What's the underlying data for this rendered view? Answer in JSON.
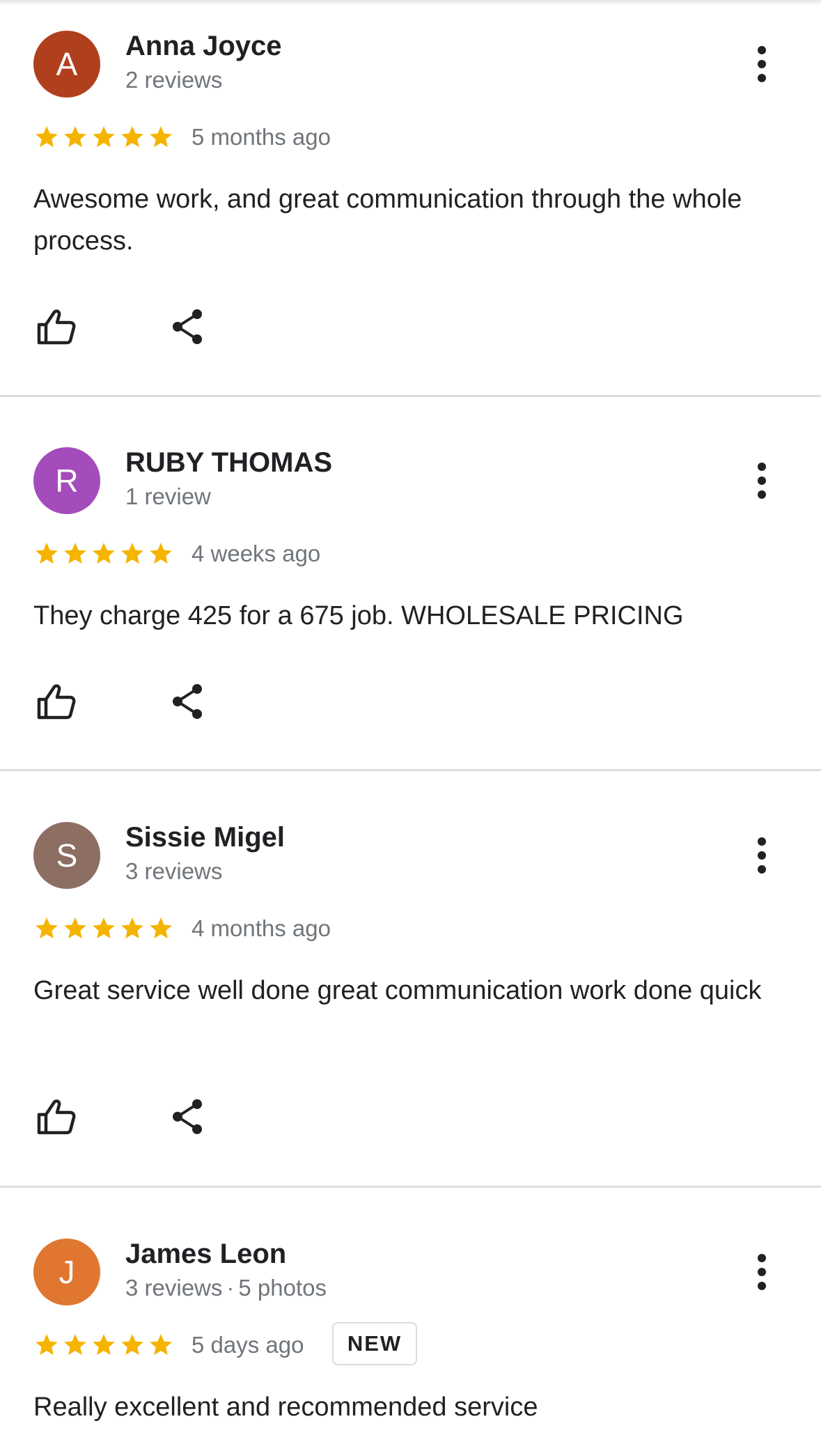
{
  "colors": {
    "star": "#f4b400",
    "text": "#202124",
    "secondary": "#70757a",
    "divider": "#dadce0"
  },
  "reviews": [
    {
      "avatar_letter": "A",
      "avatar_color": "#b0401d",
      "name": "Anna Joyce",
      "review_count": "2 reviews",
      "photo_count": "",
      "rating": 5,
      "date": "5 months ago",
      "badge": "",
      "text": "Awesome work, and great communication through the whole process."
    },
    {
      "avatar_letter": "R",
      "avatar_color": "#a54cbd",
      "name": "RUBY THOMAS",
      "review_count": "1 review",
      "photo_count": "",
      "rating": 5,
      "date": "4 weeks ago",
      "badge": "",
      "text": "They charge 425 for a 675 job. WHOLESALE PRICING"
    },
    {
      "avatar_letter": "S",
      "avatar_color": "#8d6e63",
      "name": "Sissie Migel",
      "review_count": "3 reviews",
      "photo_count": "",
      "rating": 5,
      "date": "4 months ago",
      "badge": "",
      "text": "Great service well done great communication work done quick"
    },
    {
      "avatar_letter": "J",
      "avatar_color": "#e0762f",
      "name": "James Leon",
      "review_count": "3 reviews",
      "photo_count": "5 photos",
      "rating": 5,
      "date": "5 days ago",
      "badge": "NEW",
      "text": "Really excellent and recommended service"
    }
  ],
  "icons": {
    "like": "thumbs-up-icon",
    "share": "share-icon",
    "more": "more-vert-icon",
    "star": "star-icon"
  }
}
